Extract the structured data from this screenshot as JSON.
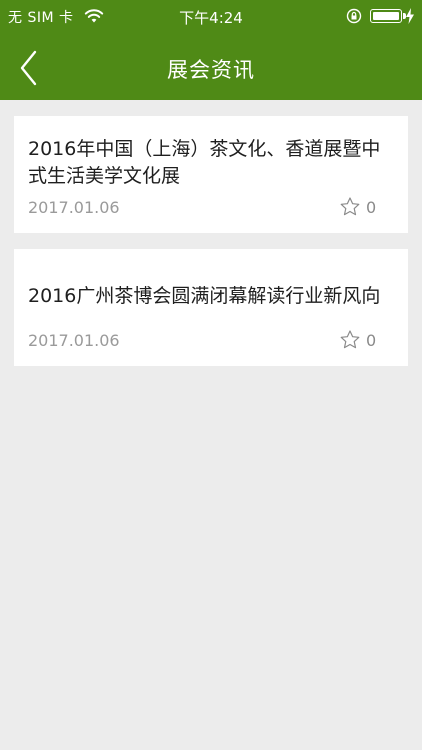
{
  "status_bar": {
    "carrier": "无 SIM 卡",
    "time": "下午4:24"
  },
  "nav": {
    "title": "展会资讯",
    "back_icon": "chevron-left-icon"
  },
  "articles": [
    {
      "title": "2016年中国（上海）茶文化、香道展暨中式生活美学文化展",
      "date": "2017.01.06",
      "favorites": "0"
    },
    {
      "title": "2016广州茶博会圆满闭幕解读行业新风向",
      "date": "2017.01.06",
      "favorites": "0"
    }
  ],
  "colors": {
    "brand_green": "#4f8a16",
    "background": "#ececec",
    "card": "#ffffff"
  }
}
